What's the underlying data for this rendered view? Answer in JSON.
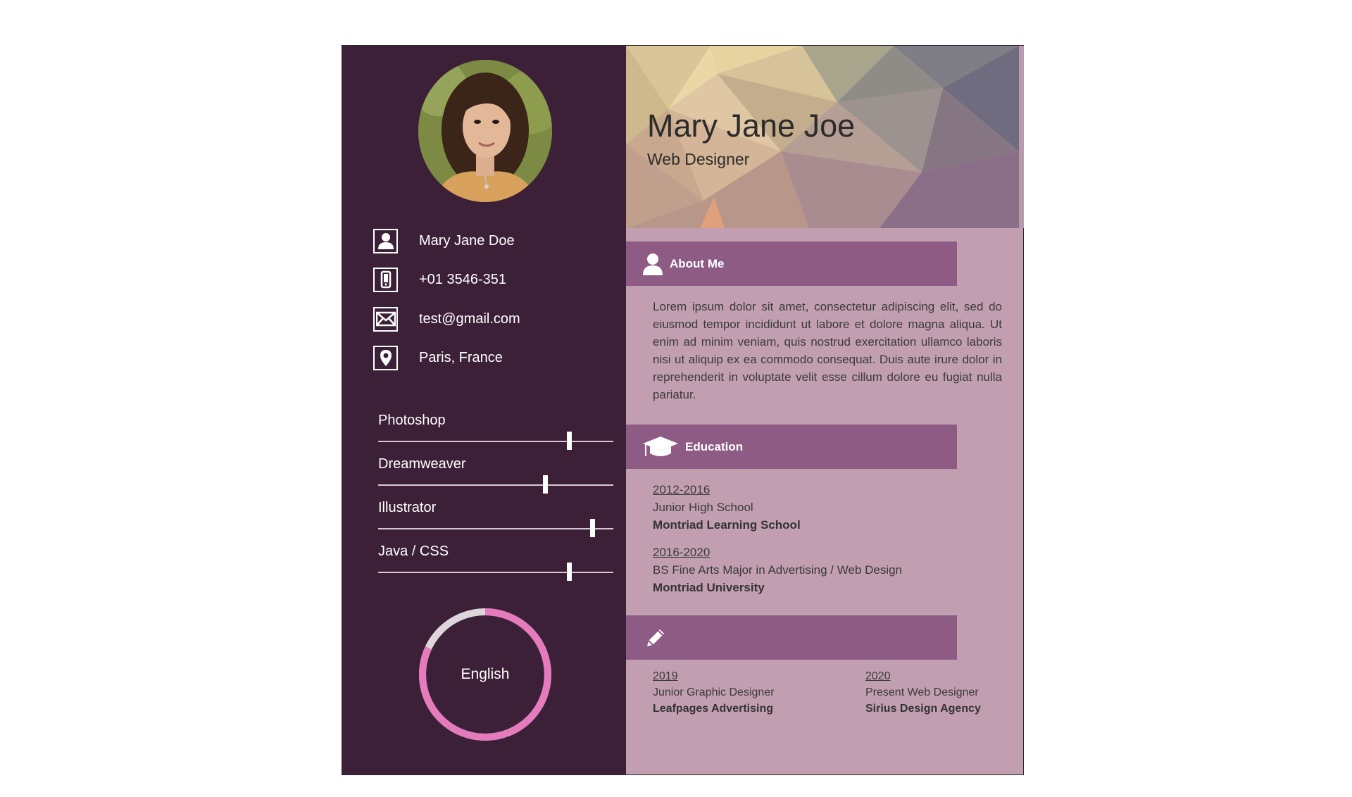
{
  "profile": {
    "name": "Mary Jane Joe",
    "title": "Web Designer"
  },
  "contacts": [
    {
      "icon": "user-icon",
      "text": "Mary Jane Doe"
    },
    {
      "icon": "phone-icon",
      "text": "+01 3546-351"
    },
    {
      "icon": "mail-icon",
      "text": "test@gmail.com"
    },
    {
      "icon": "location-icon",
      "text": "Paris, France"
    }
  ],
  "skills": [
    {
      "name": "Photoshop",
      "level": 0.81
    },
    {
      "name": "Dreamweaver",
      "level": 0.71
    },
    {
      "name": "Illustrator",
      "level": 0.91
    },
    {
      "name": "Java / CSS",
      "level": 0.81
    }
  ],
  "language": {
    "name": "English",
    "level": 0.82
  },
  "sections": {
    "about_title": "About Me",
    "education_title": "Education",
    "experience_title": ""
  },
  "about": "Lorem ipsum dolor sit amet, consectetur adipiscing elit, sed do eiusmod tempor incididunt ut labore et dolore magna aliqua. Ut enim ad minim veniam, quis nostrud exercitation ullamco laboris nisi ut aliquip ex ea commodo consequat. Duis aute irure dolor in reprehenderit in voluptate velit esse cillum dolore eu fugiat nulla pariatur.",
  "education": [
    {
      "years": "2012-2016",
      "degree": "Junior High School",
      "school": "Montriad Learning School"
    },
    {
      "years": "2016-2020",
      "degree": "BS Fine Arts Major in Advertising / Web Design",
      "school": "Montriad University"
    }
  ],
  "experience": [
    {
      "year": "2019",
      "role": "Junior Graphic Designer",
      "company": "Leafpages Advertising"
    },
    {
      "year": "2020",
      "role": "Present Web Designer",
      "company": "Sirius Design Agency"
    }
  ],
  "colors": {
    "sidebar": "#3c2038",
    "main": "#c29fb0",
    "bar": "#8d5b84",
    "ring": "#e57bbd"
  }
}
